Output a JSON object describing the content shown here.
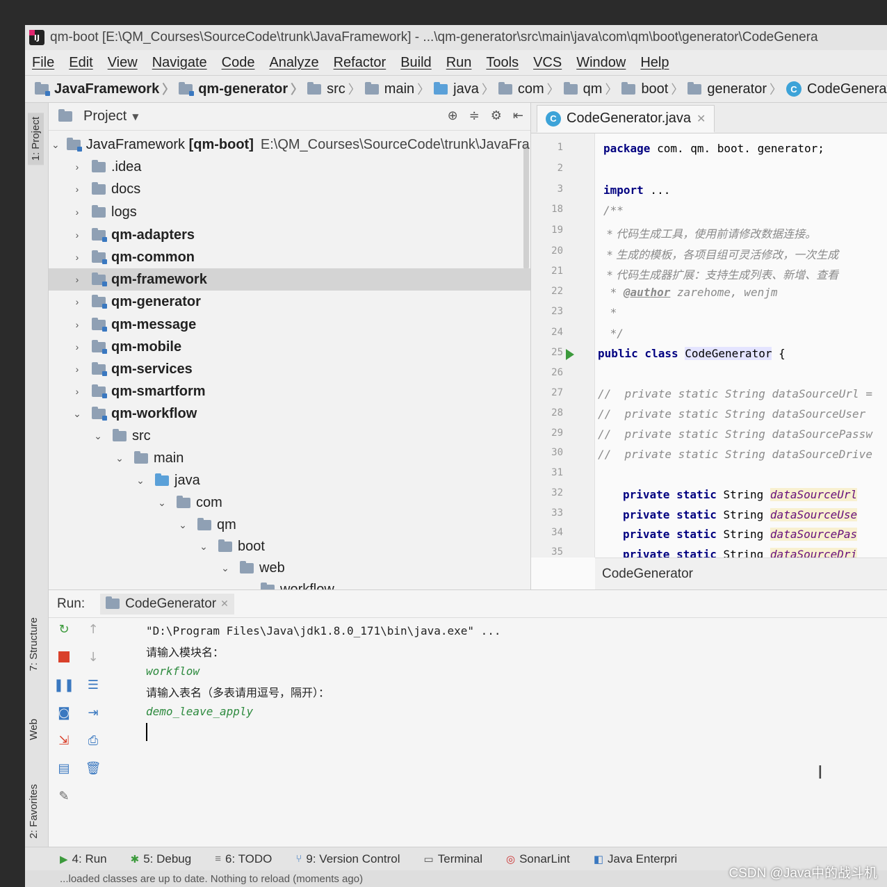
{
  "window": {
    "title": "qm-boot [E:\\QM_Courses\\SourceCode\\trunk\\JavaFramework] - ...\\qm-generator\\src\\main\\java\\com\\qm\\boot\\generator\\CodeGenera"
  },
  "menu": [
    "File",
    "Edit",
    "View",
    "Navigate",
    "Code",
    "Analyze",
    "Refactor",
    "Build",
    "Run",
    "Tools",
    "VCS",
    "Window",
    "Help"
  ],
  "breadcrumbs": [
    "JavaFramework",
    "qm-generator",
    "src",
    "main",
    "java",
    "com",
    "qm",
    "boot",
    "generator",
    "CodeGenerator"
  ],
  "side_tabs": {
    "project": "1: Project",
    "structure": "7: Structure",
    "web": "Web",
    "favorites": "2: Favorites"
  },
  "project_panel": {
    "title": "Project",
    "root": {
      "name": "JavaFramework",
      "module": "[qm-boot]",
      "path": "E:\\QM_Courses\\SourceCode\\trunk\\JavaFran"
    },
    "items": [
      {
        "label": ".idea",
        "bold": false
      },
      {
        "label": "docs",
        "bold": false
      },
      {
        "label": "logs",
        "bold": false
      },
      {
        "label": "qm-adapters",
        "bold": true
      },
      {
        "label": "qm-common",
        "bold": true
      },
      {
        "label": "qm-framework",
        "bold": true
      },
      {
        "label": "qm-generator",
        "bold": true
      },
      {
        "label": "qm-message",
        "bold": true
      },
      {
        "label": "qm-mobile",
        "bold": true
      },
      {
        "label": "qm-services",
        "bold": true
      },
      {
        "label": "qm-smartform",
        "bold": true
      },
      {
        "label": "qm-workflow",
        "bold": true
      },
      {
        "label": "src",
        "bold": false
      },
      {
        "label": "main",
        "bold": false
      },
      {
        "label": "java",
        "bold": false
      },
      {
        "label": "com",
        "bold": false
      },
      {
        "label": "qm",
        "bold": false
      },
      {
        "label": "boot",
        "bold": false
      },
      {
        "label": "web",
        "bold": false
      },
      {
        "label": "workflow",
        "bold": false
      }
    ]
  },
  "editor": {
    "tab": "CodeGenerator.java",
    "line_numbers": [
      "1",
      "2",
      "3",
      "18",
      "19",
      "20",
      "21",
      "22",
      "23",
      "24",
      "25",
      "26",
      "27",
      "28",
      "29",
      "30",
      "31",
      "32",
      "33",
      "34",
      "35"
    ],
    "code": {
      "package_kw": "package",
      "package_name": " com. qm. boot. generator;",
      "import_kw": "import",
      "import_rest": " ...",
      "doc_open": "/**",
      "doc_1": " * 代码生成工具，使用前请修改数据连接。",
      "doc_2": " * 生成的模板，各项目组可灵活修改，一次生成",
      "doc_3": " * 代码生成器扩展：支持生成列表、新增、查看",
      "doc_author_prefix": " * ",
      "doc_author_tag": "@author",
      "doc_author": " zarehome, wenjm",
      "doc_star": " *",
      "doc_close": " */",
      "class_kw": "public class",
      "class_name": "CodeGenerator",
      "class_brace": " {",
      "c1": "//  private static String dataSourceUrl =",
      "c2": "//  private static String dataSourceUser",
      "c3": "//  private static String dataSourcePassw",
      "c4": "//  private static String dataSourceDrive",
      "f_kw": "private static",
      "f_type": " String ",
      "f1": "dataSourceUrl",
      "f2": "dataSourceUse",
      "f3": "dataSourcePas",
      "f4": "dataSourceDri"
    },
    "footer": "CodeGenerator"
  },
  "run_panel": {
    "label": "Run:",
    "tab": "CodeGenerator",
    "console": [
      {
        "text": "\"D:\\Program Files\\Java\\jdk1.8.0_171\\bin\\java.exe\" ...",
        "user": false
      },
      {
        "text": "请输入模块名：",
        "user": false
      },
      {
        "text": "workflow",
        "user": true
      },
      {
        "text": "请输入表名（多表请用逗号，隔开）：",
        "user": false
      },
      {
        "text": "demo_leave_apply",
        "user": true
      }
    ]
  },
  "bottom_tools": [
    {
      "label": "4: Run",
      "icon": "run-icon"
    },
    {
      "label": "5: Debug",
      "icon": "debug-icon"
    },
    {
      "label": "6: TODO",
      "icon": "todo-icon"
    },
    {
      "label": "9: Version Control",
      "icon": "vcs-icon"
    },
    {
      "label": "Terminal",
      "icon": "terminal-icon"
    },
    {
      "label": "SonarLint",
      "icon": "sonarlint-icon"
    },
    {
      "label": "Java Enterpri",
      "icon": "java-enterprise-icon"
    }
  ],
  "status": "...loaded classes are up to date. Nothing to reload (moments ago)",
  "watermark": "CSDN @Java中的战斗机"
}
